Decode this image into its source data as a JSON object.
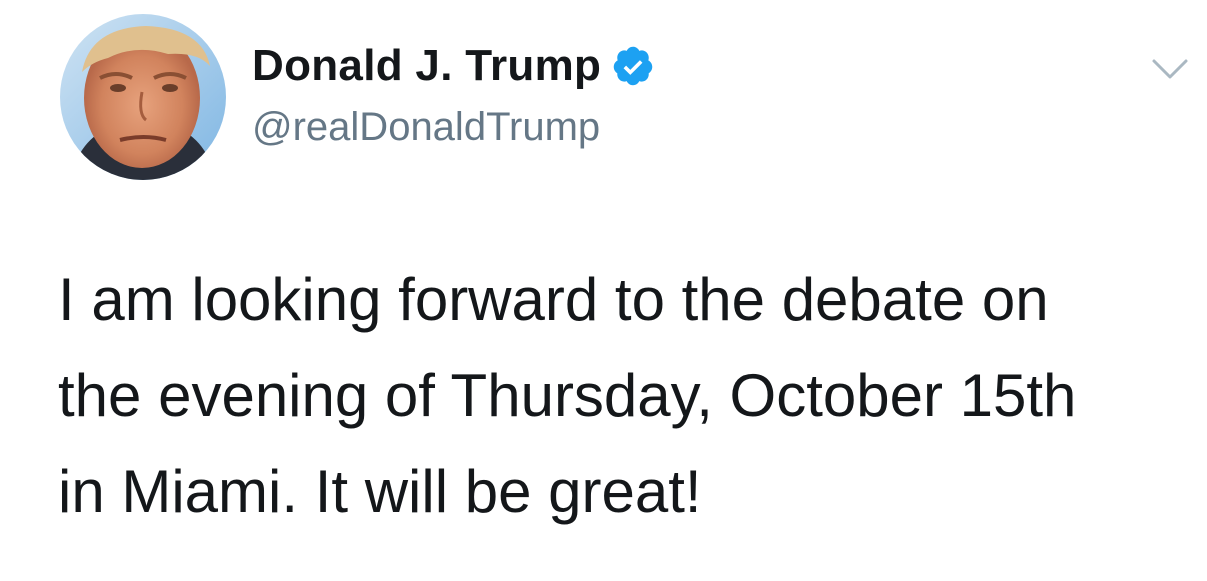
{
  "author": {
    "display_name": "Donald J. Trump",
    "handle": "@realDonaldTrump",
    "verified": true,
    "avatar_icon": "profile-photo"
  },
  "tweet": {
    "lines": [
      "I am looking forward to the debate on",
      "the evening of Thursday, October 15th",
      "in Miami. It will be great!"
    ]
  },
  "menu_icon": "chevron-down-icon",
  "colors": {
    "verified_blue": "#1da1f2",
    "handle_gray": "#657786",
    "text": "#14171a"
  }
}
